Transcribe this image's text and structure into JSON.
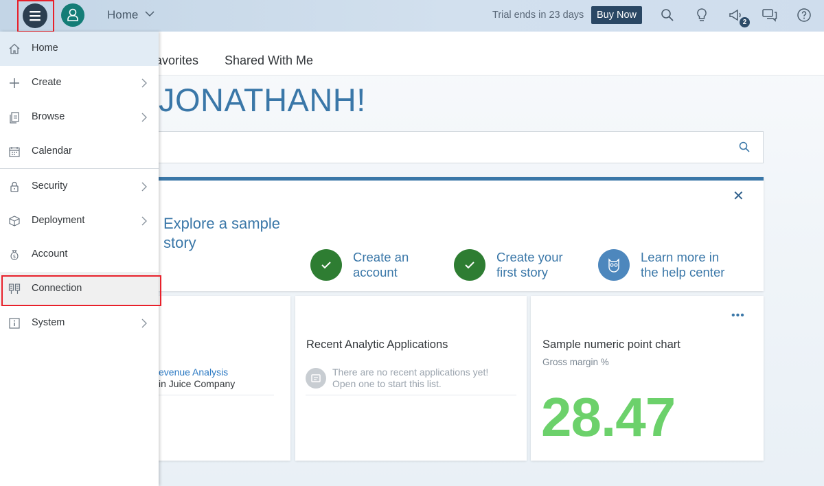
{
  "topbar": {
    "nav_label": "Home",
    "trial_text": "Trial ends in 23 days",
    "buy_label": "Buy Now",
    "notification_count": "2"
  },
  "tabs": {
    "favorites": "avorites",
    "shared": "Shared With Me"
  },
  "greeting": "JONATHANH!",
  "banner": {
    "close": "✕",
    "title_line1": "Explore a sample",
    "title_line2": "story",
    "steps": [
      {
        "line1": "Create an",
        "line2": "account"
      },
      {
        "line1": "Create your",
        "line2": "first story"
      },
      {
        "line1": "Learn more in",
        "line2": "the help center"
      }
    ]
  },
  "cards": {
    "recent_story": {
      "link": "evenue Analysis",
      "sub": "in Juice Company"
    },
    "recent_apps": {
      "title": "Recent Analytic Applications",
      "empty_line1": "There are no recent applications yet!",
      "empty_line2": "Open one to start this list."
    },
    "sample_chart": {
      "title": "Sample numeric point chart",
      "subtitle": "Gross margin %",
      "value": "28.47",
      "more": "•••"
    }
  },
  "menu": {
    "items": [
      {
        "label": "Home"
      },
      {
        "label": "Create"
      },
      {
        "label": "Browse"
      },
      {
        "label": "Calendar"
      },
      {
        "label": "Security"
      },
      {
        "label": "Deployment"
      },
      {
        "label": "Account"
      },
      {
        "label": "Connection"
      },
      {
        "label": "System"
      }
    ]
  },
  "colors": {
    "accent": "#3a77a8",
    "header_dark": "#2b3e50",
    "avatar": "#147d77",
    "check_green": "#2e7d32",
    "kpi_green": "#6cd16b",
    "highlight_red": "#e8202a"
  }
}
